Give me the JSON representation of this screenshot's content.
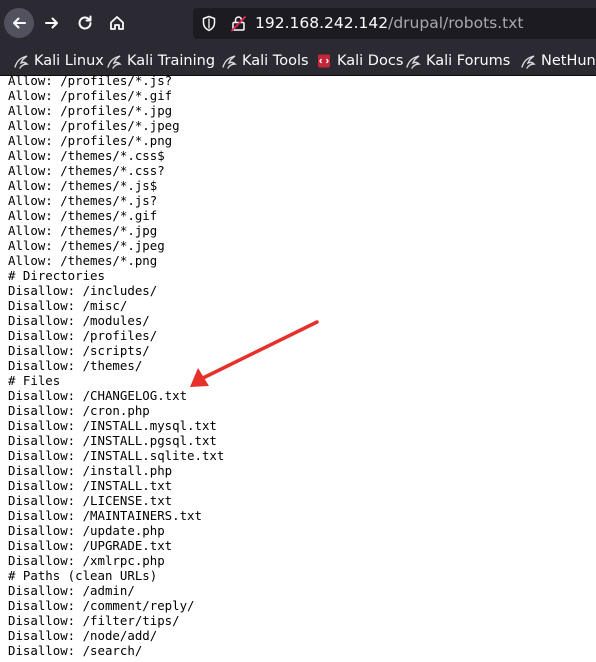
{
  "browser": {
    "url_host": "192.168.242.142",
    "url_path": "/drupal/robots.txt"
  },
  "bookmarks": [
    {
      "label": "Kali Linux",
      "icon": "kali-dragon-icon"
    },
    {
      "label": "Kali Training",
      "icon": "kali-dragon-icon"
    },
    {
      "label": "Kali Tools",
      "icon": "kali-dragon-icon"
    },
    {
      "label": "Kali Docs",
      "icon": "kali-docs-icon"
    },
    {
      "label": "Kali Forums",
      "icon": "kali-dragon-icon"
    },
    {
      "label": "NetHunter",
      "icon": "kali-dragon-icon"
    }
  ],
  "lines": [
    "Allow: /profiles/*.js?",
    "Allow: /profiles/*.gif",
    "Allow: /profiles/*.jpg",
    "Allow: /profiles/*.jpeg",
    "Allow: /profiles/*.png",
    "Allow: /themes/*.css$",
    "Allow: /themes/*.css?",
    "Allow: /themes/*.js$",
    "Allow: /themes/*.js?",
    "Allow: /themes/*.gif",
    "Allow: /themes/*.jpg",
    "Allow: /themes/*.jpeg",
    "Allow: /themes/*.png",
    "# Directories",
    "Disallow: /includes/",
    "Disallow: /misc/",
    "Disallow: /modules/",
    "Disallow: /profiles/",
    "Disallow: /scripts/",
    "Disallow: /themes/",
    "# Files",
    "Disallow: /CHANGELOG.txt",
    "Disallow: /cron.php",
    "Disallow: /INSTALL.mysql.txt",
    "Disallow: /INSTALL.pgsql.txt",
    "Disallow: /INSTALL.sqlite.txt",
    "Disallow: /install.php",
    "Disallow: /INSTALL.txt",
    "Disallow: /LICENSE.txt",
    "Disallow: /MAINTAINERS.txt",
    "Disallow: /update.php",
    "Disallow: /UPGRADE.txt",
    "Disallow: /xmlrpc.php",
    "# Paths (clean URLs)",
    "Disallow: /admin/",
    "Disallow: /comment/reply/",
    "Disallow: /filter/tips/",
    "Disallow: /node/add/",
    "Disallow: /search/"
  ],
  "colors": {
    "toolbar_bg": "#2b2a33",
    "urlbar_bg": "#1c1b22",
    "annotation_arrow": "#e8302a"
  }
}
